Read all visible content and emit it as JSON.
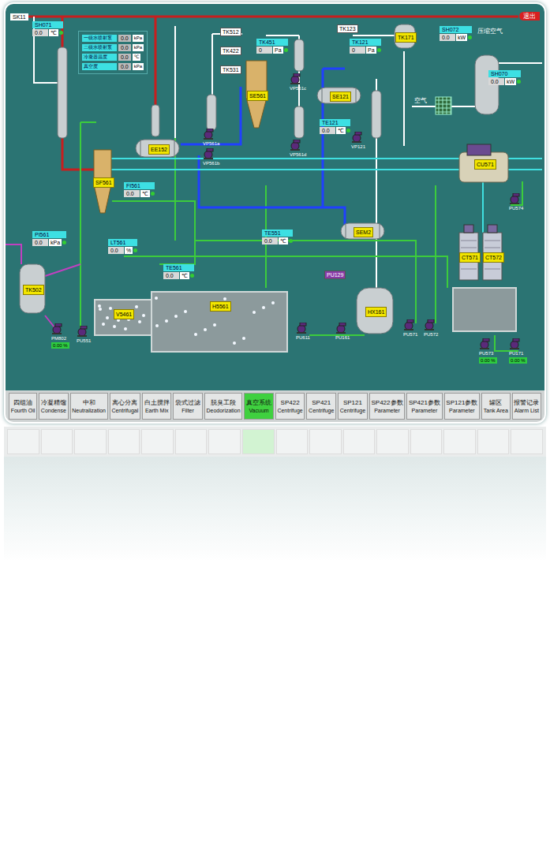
{
  "window": {
    "tag": "SK11",
    "exit_button": "退出"
  },
  "legend": [
    {
      "label": "一级水喷射泵",
      "value": "0.0",
      "unit": "kPa"
    },
    {
      "label": "二级水喷射泵",
      "value": "0.0",
      "unit": "kPa"
    },
    {
      "label": "冷凝器温度",
      "value": "0.0",
      "unit": "℃"
    },
    {
      "label": "真空度",
      "value": "0.0",
      "unit": "kPa"
    }
  ],
  "equipment": [
    {
      "label": "SF561",
      "kind": "cyclone"
    },
    {
      "label": "EE152",
      "kind": "exchanger"
    },
    {
      "label": "SE561",
      "kind": "cyclone"
    },
    {
      "label": "SE121",
      "kind": "exchanger"
    },
    {
      "label": "SEM2",
      "kind": "exchanger"
    },
    {
      "label": "TK171",
      "kind": "vessel"
    },
    {
      "label": "CU571",
      "kind": "chiller"
    },
    {
      "label": "CT571",
      "kind": "tower"
    },
    {
      "label": "CT572",
      "kind": "tower"
    },
    {
      "label": "HX161",
      "kind": "vessel"
    },
    {
      "label": "TK502",
      "kind": "vessel"
    },
    {
      "label": "V5461",
      "kind": "basin"
    },
    {
      "label": "H5561",
      "kind": "basin"
    }
  ],
  "readouts": [
    {
      "label": "SH071",
      "value": "0.0",
      "unit": "℃"
    },
    {
      "label": "SH072",
      "value": "0.0",
      "unit": "kW"
    },
    {
      "label": "SH070",
      "value": "0.0",
      "unit": "kW"
    },
    {
      "label": "TK451",
      "value": "0",
      "unit": "Pa"
    },
    {
      "label": "TK121",
      "value": "0",
      "unit": "Pa"
    },
    {
      "label": "TE121",
      "value": "0.0",
      "unit": "℃"
    },
    {
      "label": "FI561",
      "value": "0.0",
      "unit": "℃"
    },
    {
      "label": "PI561",
      "value": "0.0",
      "unit": "kPa"
    },
    {
      "label": "LT561",
      "value": "0.0",
      "unit": "%"
    },
    {
      "label": "TE551",
      "value": "0.0",
      "unit": "℃"
    },
    {
      "label": "TE561",
      "value": "0.0",
      "unit": "℃"
    }
  ],
  "tags": [
    "TK512",
    "TK422",
    "TK531",
    "TK123",
    "PU129"
  ],
  "pumps": [
    {
      "label": "PM802",
      "reading": "0.00 %"
    },
    {
      "label": "PU551",
      "reading": ""
    },
    {
      "label": "PU611",
      "reading": ""
    },
    {
      "label": "PU161",
      "reading": ""
    },
    {
      "label": "PU571",
      "reading": ""
    },
    {
      "label": "PU572",
      "reading": ""
    },
    {
      "label": "PU573",
      "reading": "0.00 %"
    },
    {
      "label": "PU171",
      "reading": "0.00 %"
    },
    {
      "label": "PU574",
      "reading": ""
    },
    {
      "label": "VP561a",
      "reading": ""
    },
    {
      "label": "VP561b",
      "reading": ""
    },
    {
      "label": "VP561c",
      "reading": ""
    },
    {
      "label": "VP561d",
      "reading": ""
    },
    {
      "label": "VP121",
      "reading": ""
    }
  ],
  "streams": [
    "压缩空气",
    "空气"
  ],
  "nav": [
    {
      "zh": "四组油",
      "en": "Fourth Oil",
      "selected": false
    },
    {
      "zh": "冷凝精馏",
      "en": "Condense",
      "selected": false
    },
    {
      "zh": "中和",
      "en": "Neutralization",
      "selected": false
    },
    {
      "zh": "离心分离",
      "en": "Centrifugal",
      "selected": false
    },
    {
      "zh": "白土搅拌",
      "en": "Earth Mix",
      "selected": false
    },
    {
      "zh": "袋式过滤",
      "en": "Filter",
      "selected": false
    },
    {
      "zh": "脱臭工段",
      "en": "Deodorization",
      "selected": false
    },
    {
      "zh": "真空系统",
      "en": "Vacuum",
      "selected": true
    },
    {
      "zh": "SP422",
      "en": "Centrifuge",
      "selected": false
    },
    {
      "zh": "SP421",
      "en": "Centrifuge",
      "selected": false
    },
    {
      "zh": "SP121",
      "en": "Centrifuge",
      "selected": false
    },
    {
      "zh": "SP422参数",
      "en": "Parameter",
      "selected": false
    },
    {
      "zh": "SP421参数",
      "en": "Parameter",
      "selected": false
    },
    {
      "zh": "SP121参数",
      "en": "Parameter",
      "selected": false
    },
    {
      "zh": "罐区",
      "en": "Tank Area",
      "selected": false
    },
    {
      "zh": "报警记录",
      "en": "Alarm List",
      "selected": false
    }
  ]
}
